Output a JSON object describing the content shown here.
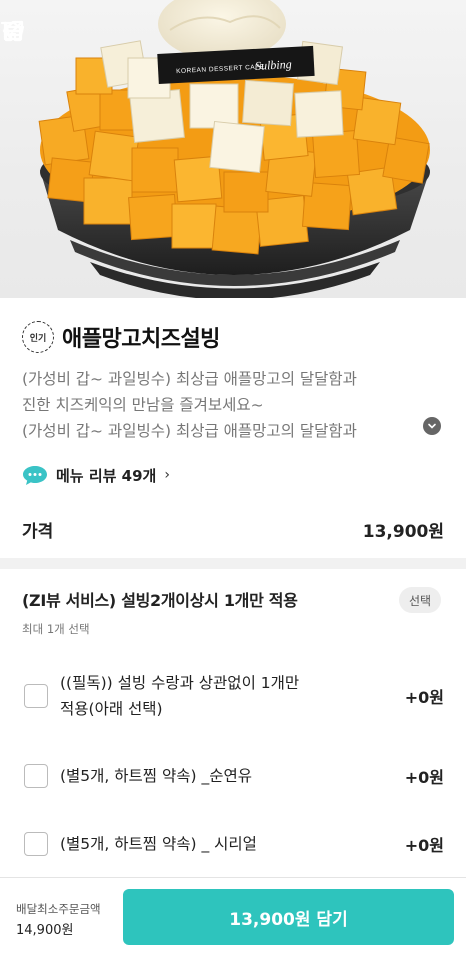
{
  "header": {
    "back_icon": "arrow-left-icon",
    "home_icon": "home-icon",
    "share_icon": "share-external-icon",
    "cart_icon": "cart-icon"
  },
  "hero": {
    "logo_line1": "KOREAN DESSERT CAFE",
    "logo_line2": "Sulbing"
  },
  "product": {
    "badge": "인기",
    "title": "애플망고치즈설빙",
    "description": [
      "(가성비 갑~ 과일빙수) 최상급 애플망고의 달달함과",
      "진한 치즈케익의 만남을 즐겨보세요~",
      "(가성비 갑~ 과일빙수) 최상급 애플망고의 달달함과"
    ],
    "review_label": "메뉴 리뷰 49개",
    "price_label": "가격",
    "price_value": "13,900원"
  },
  "options": {
    "header": "(ZI뷰 서비스) 설빙2개이상시 1개만 적용",
    "tag": "선택",
    "sub": "최대 1개 선택",
    "items": [
      {
        "label_line1": "((필독)) 설빙 수랑과  상관없이 1개만",
        "label_line2": "적용(아래 선택)",
        "price": "+0원"
      },
      {
        "label_line1": "(별5개, 하트찜 약속) _순연유",
        "label_line2": "",
        "price": "+0원"
      },
      {
        "label_line1": "(별5개, 하트찜 약속) _ 시리얼",
        "label_line2": "",
        "price": "+0원"
      }
    ]
  },
  "bottom": {
    "min_order_label": "배달최소주문금액",
    "min_order_value": "14,900원",
    "cart_button": "13,900원 담기"
  },
  "colors": {
    "accent": "#2ec4bd",
    "mango": "#f6a11f",
    "review_bubble": "#3ac3c6"
  }
}
